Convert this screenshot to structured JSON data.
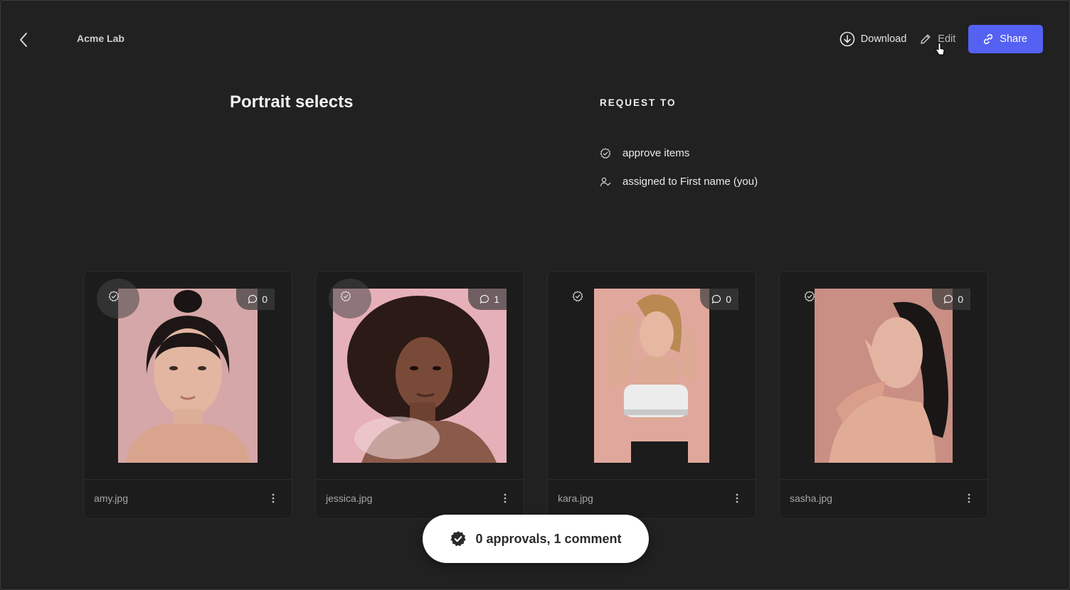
{
  "header": {
    "workspace": "Acme Lab",
    "download_label": "Download",
    "edit_label": "Edit",
    "share_label": "Share",
    "share_color": "#5561f2"
  },
  "page": {
    "title": "Portrait selects",
    "request_heading": "REQUEST TO",
    "request_items": [
      {
        "icon": "approve-badge-icon",
        "label": "approve items"
      },
      {
        "icon": "user-check-icon",
        "label": "assigned to First name (you)"
      }
    ]
  },
  "cards": [
    {
      "filename": "amy.jpg",
      "comments": "0"
    },
    {
      "filename": "jessica.jpg",
      "comments": "1"
    },
    {
      "filename": "kara.jpg",
      "comments": "0"
    },
    {
      "filename": "sasha.jpg",
      "comments": "0"
    }
  ],
  "summary": {
    "text": "0 approvals, 1 comment"
  }
}
